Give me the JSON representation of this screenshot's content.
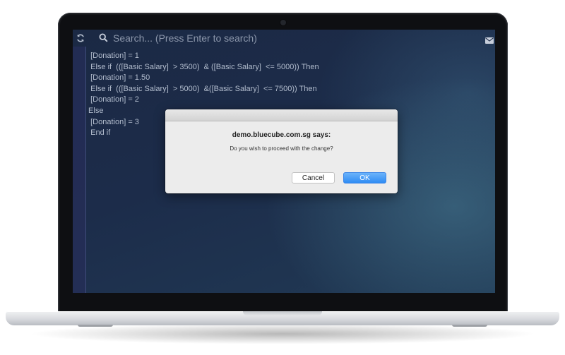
{
  "search": {
    "placeholder": "Search... (Press Enter to search)",
    "icons": [
      "refresh-icon",
      "search-icon",
      "mail-icon"
    ]
  },
  "code": {
    "lines": [
      "  [Donation] = 1",
      "  Else if  (([Basic Salary]  > 3500)  & ([Basic Salary]  <= 5000)) Then",
      "  [Donation] = 1.50",
      "  Else if  (([Basic Salary]  > 5000)  &([Basic Salary]  <= 7500)) Then",
      "  [Donation] = 2",
      " Else",
      "  [Donation] = 3",
      "  End if"
    ]
  },
  "dialog": {
    "title": "demo.bluecube.com.sg says:",
    "message": "Do you wish to proceed with the change?",
    "cancel_label": "Cancel",
    "ok_label": "OK"
  },
  "colors": {
    "screen_background": "#1c2c4a",
    "code_text": "#b2bccd",
    "ok_button": "#2f8cf4"
  }
}
